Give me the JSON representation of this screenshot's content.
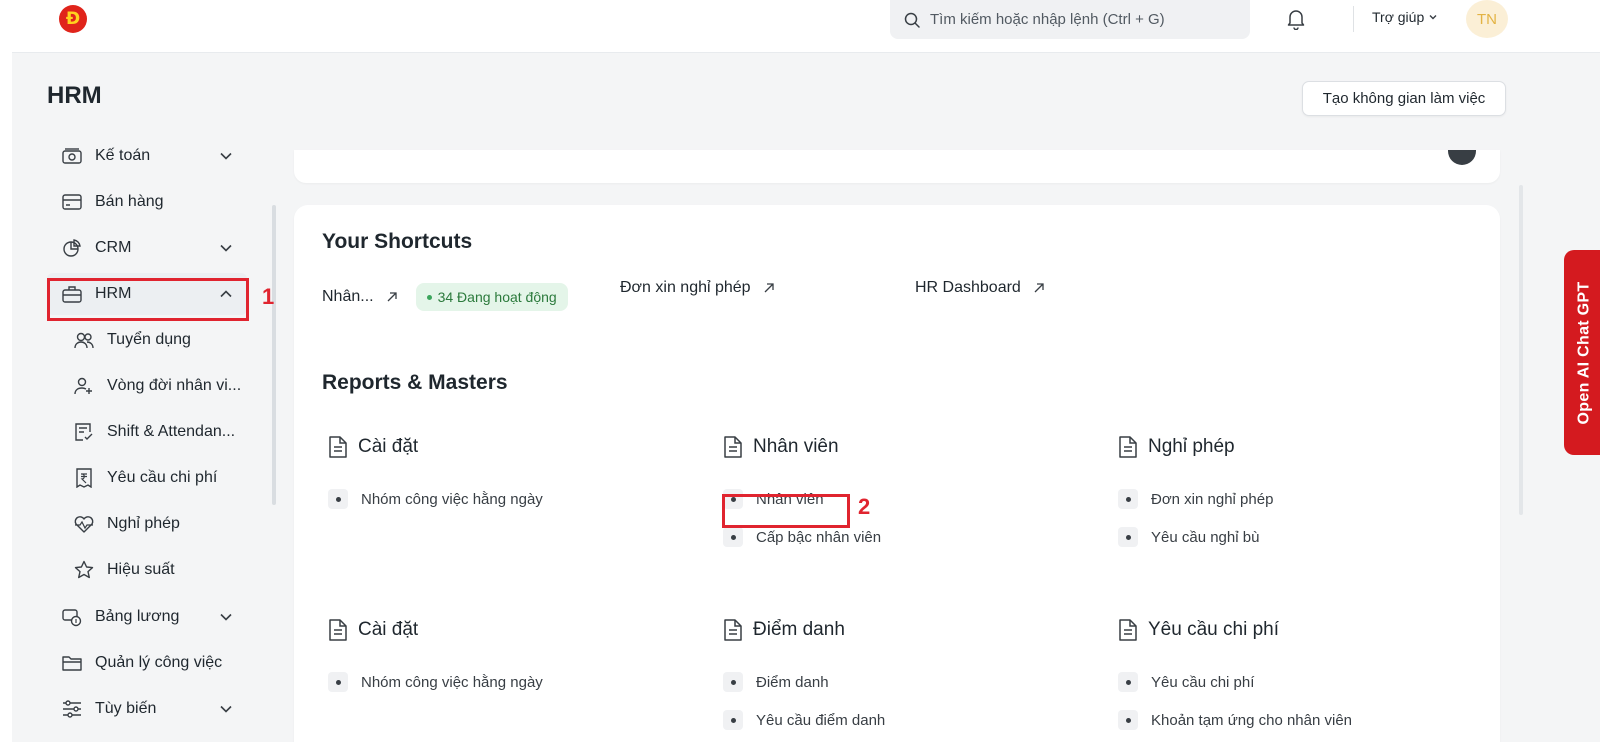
{
  "navbar": {
    "logo_text": "Đ",
    "search_placeholder": "Tìm kiếm hoặc nhập lệnh (Ctrl + G)",
    "help_label": "Trợ giúp",
    "avatar_initials": "TN"
  },
  "page": {
    "title": "HRM",
    "create_workspace_label": "Tạo không gian làm việc"
  },
  "sidebar": {
    "items": [
      {
        "label": "Kế toán",
        "icon": "accounting-icon",
        "expandable": true
      },
      {
        "label": "Bán hàng",
        "icon": "sales-icon",
        "expandable": false
      },
      {
        "label": "CRM",
        "icon": "crm-icon",
        "expandable": true
      },
      {
        "label": "HRM",
        "icon": "hrm-icon",
        "expandable": true,
        "expanded": true
      },
      {
        "label": "Tuyển dụng",
        "icon": "recruitment-icon"
      },
      {
        "label": "Vòng đời nhân vi...",
        "icon": "employee-lifecycle-icon"
      },
      {
        "label": "Shift & Attendan...",
        "icon": "shift-attendance-icon"
      },
      {
        "label": "Yêu cầu chi phí",
        "icon": "expense-claim-icon"
      },
      {
        "label": "Nghỉ phép",
        "icon": "leave-icon"
      },
      {
        "label": "Hiệu suất",
        "icon": "performance-icon"
      },
      {
        "label": "Bảng lương",
        "icon": "payroll-icon",
        "expandable": true
      },
      {
        "label": "Quản lý công việc",
        "icon": "projects-icon",
        "expandable": false
      },
      {
        "label": "Tùy biến",
        "icon": "customization-icon",
        "expandable": true
      }
    ]
  },
  "annotations": {
    "mark_1": "1",
    "mark_2": "2"
  },
  "shortcuts": {
    "title": "Your Shortcuts",
    "items": [
      {
        "label": "Nhân...",
        "badge": "34 Đang hoạt động"
      },
      {
        "label": "Đơn xin nghỉ phép"
      },
      {
        "label": "HR Dashboard"
      }
    ]
  },
  "reports": {
    "title": "Reports & Masters",
    "groups": [
      {
        "title": "Cài đặt",
        "links": [
          "Nhóm công việc hằng ngày"
        ]
      },
      {
        "title": "Nhân viên",
        "links": [
          "Nhân viên",
          "Cấp bậc nhân viên"
        ]
      },
      {
        "title": "Nghỉ phép",
        "links": [
          "Đơn xin nghỉ phép",
          "Yêu cầu nghỉ bù"
        ]
      },
      {
        "title": "Cài đặt",
        "links": [
          "Nhóm công việc hằng ngày"
        ]
      },
      {
        "title": "Điểm danh",
        "links": [
          "Điểm danh",
          "Yêu cầu điểm danh"
        ]
      },
      {
        "title": "Yêu cầu chi phí",
        "links": [
          "Yêu cầu chi phí",
          "Khoản tạm ứng cho nhân viên"
        ]
      }
    ]
  },
  "chat_gpt_tab": "Open AI Chat GPT",
  "colors": {
    "highlight_red": "#e0242f",
    "gpt_tab": "#d41a1f",
    "badge_green_bg": "#e4f5e9",
    "badge_green_text": "#2b7a3c"
  }
}
